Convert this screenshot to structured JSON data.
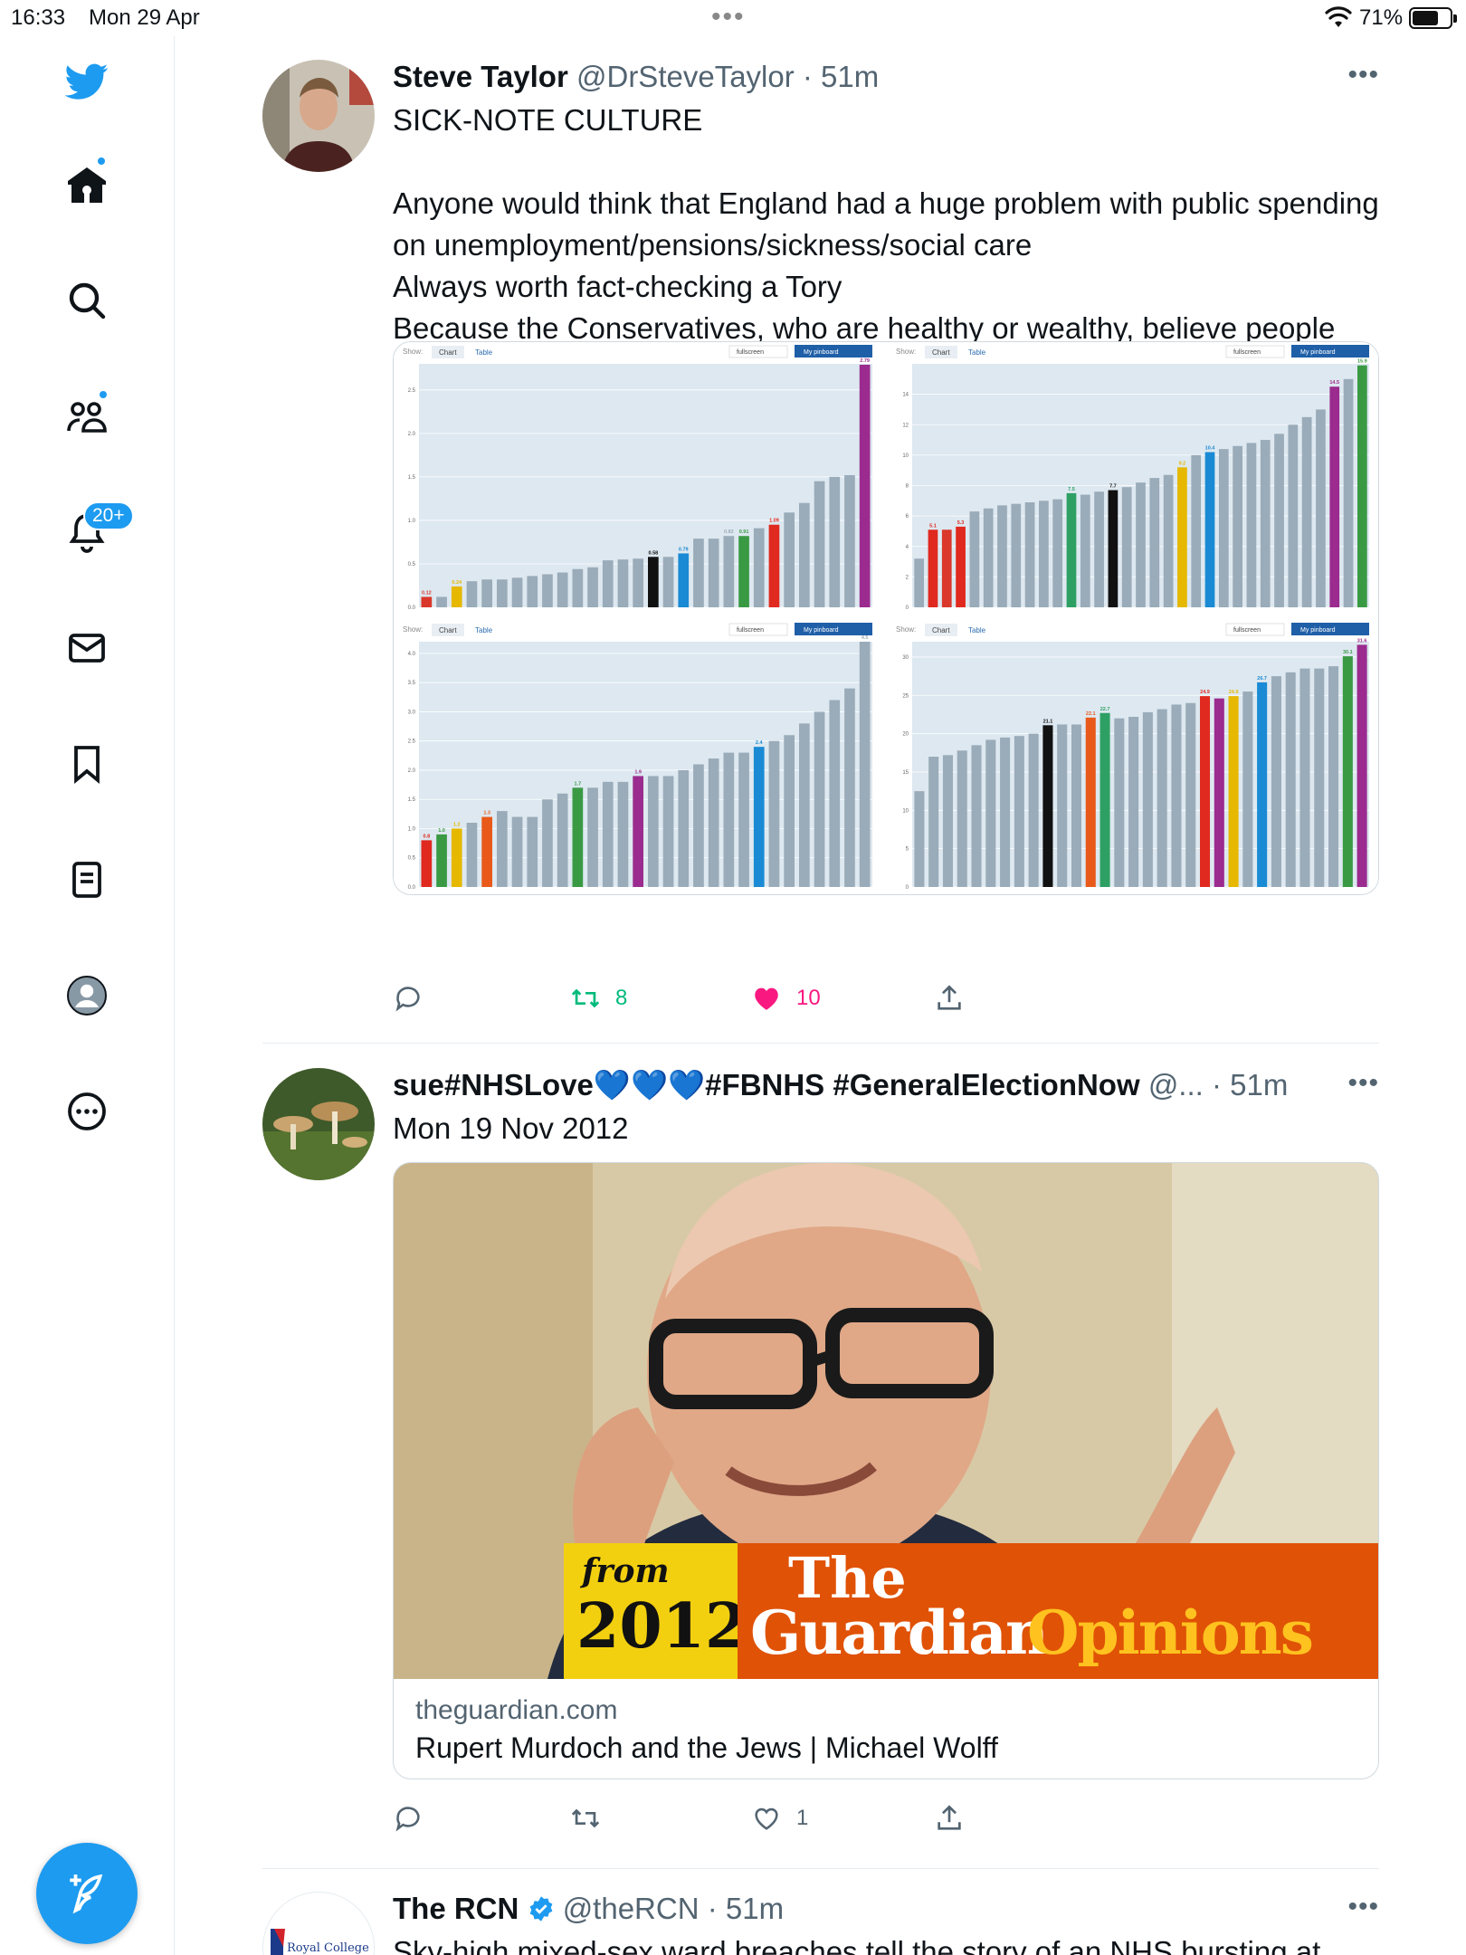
{
  "status_bar": {
    "time": "16:33",
    "date": "Mon 29 Apr",
    "battery": "71%",
    "battery_level": 0.71
  },
  "sidebar": {
    "notifications_badge": "20+"
  },
  "tweets": [
    {
      "name": "Steve Taylor",
      "handle": "@DrSteveTaylor",
      "time": "· 51m",
      "text": "SICK-NOTE CULTURE\n\nAnyone would think that England had a huge problem with public spending on unemployment/pensions/sickness/social care\nAlways worth fact-checking a Tory\nBecause the Conservatives, who are healthy or wealthy, believe people who have needs are unworthy of support",
      "retweets": "8",
      "likes": "10"
    },
    {
      "name": "sue#NHSLove💙💙💙#FBNHS #GeneralElectionNow",
      "handle": "@...",
      "time": "· 51m",
      "text": "Mon 19 Nov 2012",
      "card": {
        "banner_from": "from",
        "banner_year": "2012",
        "banner_the": "The",
        "banner_guardian": "Guardian",
        "banner_opinions": "Opinions",
        "domain": "theguardian.com",
        "title": "Rupert Murdoch and the Jews | Michael Wolff"
      },
      "retweets": "",
      "likes": "1"
    },
    {
      "name": "The RCN",
      "handle": "@theRCN",
      "time": "· 51m",
      "text": "Sky-high mixed-sex ward breaches tell the story of an NHS bursting at",
      "avatar_label": "Royal College"
    }
  ],
  "chart_ui": {
    "show": "Show:",
    "chart_tab": "Chart",
    "table_tab": "Table",
    "fullscreen": "fullscreen",
    "pinboard": "My pinboard"
  },
  "chart_data": [
    {
      "type": "bar",
      "ylim": [
        0,
        2.8
      ],
      "yticks": [
        "0.0",
        "0.5",
        "1.0",
        "1.5",
        "2.0",
        "2.5"
      ],
      "ytick_values": [
        0,
        0.5,
        1.0,
        1.5,
        2.0,
        2.5
      ],
      "values": [
        0.12,
        0.12,
        0.24,
        0.3,
        0.32,
        0.32,
        0.34,
        0.36,
        0.38,
        0.4,
        0.44,
        0.46,
        0.54,
        0.55,
        0.56,
        0.58,
        0.58,
        0.62,
        0.79,
        0.79,
        0.82,
        0.82,
        0.91,
        0.95,
        1.09,
        1.2,
        1.45,
        1.5,
        1.52,
        2.79
      ],
      "colors": [
        "#d9382b",
        "#9aabb9",
        "#e6b800",
        "#9aabb9",
        "#9aabb9",
        "#9aabb9",
        "#9aabb9",
        "#9aabb9",
        "#9aabb9",
        "#9aabb9",
        "#9aabb9",
        "#9aabb9",
        "#9aabb9",
        "#9aabb9",
        "#9aabb9",
        "#111111",
        "#9aabb9",
        "#1a8ad4",
        "#9aabb9",
        "#9aabb9",
        "#9aabb9",
        "#3a9a44",
        "#9aabb9",
        "#e0291f",
        "#9aabb9",
        "#9aabb9",
        "#9aabb9",
        "#9aabb9",
        "#9aabb9",
        "#9b2b8e"
      ],
      "labels": [
        "0.12",
        "",
        "0.24",
        "",
        "",
        "",
        "",
        "",
        "",
        "",
        "",
        "",
        "",
        "",
        "",
        "0.58",
        "",
        "0.79",
        "",
        "",
        "0.82",
        "0.91",
        "",
        "1.09",
        "",
        "",
        "",
        "",
        "",
        "2.79"
      ]
    },
    {
      "type": "bar",
      "ylim": [
        0,
        16
      ],
      "yticks": [
        "0",
        "2",
        "4",
        "6",
        "8",
        "10",
        "12",
        "14"
      ],
      "ytick_values": [
        0,
        2,
        4,
        6,
        8,
        10,
        12,
        14
      ],
      "values": [
        3.2,
        5.1,
        5.1,
        5.3,
        6.3,
        6.5,
        6.7,
        6.8,
        6.9,
        7.0,
        7.1,
        7.5,
        7.4,
        7.6,
        7.7,
        7.9,
        8.2,
        8.5,
        8.7,
        9.2,
        10.0,
        10.2,
        10.4,
        10.6,
        10.8,
        11.0,
        11.4,
        12.0,
        12.5,
        13.0,
        14.5,
        15.0,
        15.9
      ],
      "colors": [
        "#9aabb9",
        "#e0291f",
        "#d9382b",
        "#e0291f",
        "#9aabb9",
        "#9aabb9",
        "#9aabb9",
        "#9aabb9",
        "#9aabb9",
        "#9aabb9",
        "#9aabb9",
        "#2ea063",
        "#9aabb9",
        "#9aabb9",
        "#111111",
        "#9aabb9",
        "#9aabb9",
        "#9aabb9",
        "#9aabb9",
        "#e6b800",
        "#9aabb9",
        "#1a8ad4",
        "#9aabb9",
        "#9aabb9",
        "#9aabb9",
        "#9aabb9",
        "#9aabb9",
        "#9aabb9",
        "#9aabb9",
        "#9aabb9",
        "#9b2b8e",
        "#9aabb9",
        "#3a9a44"
      ],
      "labels": [
        "",
        "5.1",
        "",
        "5.3",
        "",
        "",
        "",
        "",
        "",
        "",
        "",
        "7.5",
        "",
        "",
        "7.7",
        "",
        "",
        "",
        "",
        "9.2",
        "",
        "10.4",
        "",
        "",
        "",
        "",
        "",
        "",
        "",
        "",
        "14.5",
        "",
        "15.9"
      ]
    },
    {
      "type": "bar",
      "ylim": [
        0,
        4.2
      ],
      "yticks": [
        "0.0",
        "0.5",
        "1.0",
        "1.5",
        "2.0",
        "2.5",
        "3.0",
        "3.5",
        "4.0"
      ],
      "ytick_values": [
        0,
        0.5,
        1.0,
        1.5,
        2.0,
        2.5,
        3.0,
        3.5,
        4.0
      ],
      "values": [
        0.8,
        0.9,
        1.0,
        1.1,
        1.2,
        1.3,
        1.2,
        1.2,
        1.5,
        1.6,
        1.7,
        1.7,
        1.8,
        1.8,
        1.9,
        1.9,
        1.9,
        2.0,
        2.1,
        2.2,
        2.3,
        2.3,
        2.4,
        2.5,
        2.6,
        2.8,
        3.0,
        3.2,
        3.4,
        4.5
      ],
      "colors": [
        "#e0291f",
        "#3a9a44",
        "#e6b800",
        "#9aabb9",
        "#e8591a",
        "#9aabb9",
        "#9aabb9",
        "#9aabb9",
        "#9aabb9",
        "#9aabb9",
        "#3a9a44",
        "#9aabb9",
        "#9aabb9",
        "#9aabb9",
        "#9b2b8e",
        "#9aabb9",
        "#9aabb9",
        "#9aabb9",
        "#9aabb9",
        "#9aabb9",
        "#9aabb9",
        "#9aabb9",
        "#1a8ad4",
        "#9aabb9",
        "#9aabb9",
        "#9aabb9",
        "#9aabb9",
        "#9aabb9",
        "#9aabb9",
        "#9aabb9"
      ],
      "labels": [
        "0.8",
        "1.0",
        "1.2",
        "",
        "1.3",
        "",
        "",
        "",
        "",
        "",
        "1.7",
        "",
        "",
        "",
        "1.9",
        "",
        "",
        "",
        "",
        "",
        "",
        "",
        "2.4",
        "",
        "",
        "",
        "",
        "",
        "",
        "4.5"
      ]
    },
    {
      "type": "bar",
      "ylim": [
        0,
        32
      ],
      "yticks": [
        "0",
        "5",
        "10",
        "15",
        "20",
        "25",
        "30"
      ],
      "ytick_values": [
        0,
        5,
        10,
        15,
        20,
        25,
        30
      ],
      "values": [
        12.5,
        17.0,
        17.2,
        17.8,
        18.5,
        19.2,
        19.5,
        19.7,
        20.0,
        21.1,
        21.2,
        21.2,
        22.1,
        22.7,
        22.0,
        22.2,
        22.8,
        23.2,
        23.8,
        24.0,
        24.9,
        24.6,
        24.9,
        25.5,
        26.7,
        27.5,
        28.0,
        28.5,
        28.5,
        28.8,
        30.1,
        31.6
      ],
      "colors": [
        "#9aabb9",
        "#9aabb9",
        "#9aabb9",
        "#9aabb9",
        "#9aabb9",
        "#9aabb9",
        "#9aabb9",
        "#9aabb9",
        "#9aabb9",
        "#111111",
        "#9aabb9",
        "#9aabb9",
        "#e8591a",
        "#2ea063",
        "#9aabb9",
        "#9aabb9",
        "#9aabb9",
        "#9aabb9",
        "#9aabb9",
        "#9aabb9",
        "#e0291f",
        "#9b2b8e",
        "#e6b800",
        "#9aabb9",
        "#1a8ad4",
        "#9aabb9",
        "#9aabb9",
        "#9aabb9",
        "#9aabb9",
        "#9aabb9",
        "#3a9a44",
        "#9b2b8e"
      ],
      "labels": [
        "",
        "",
        "",
        "",
        "",
        "",
        "",
        "",
        "",
        "21.1",
        "",
        "",
        "22.1",
        "22.7",
        "",
        "",
        "",
        "",
        "",
        "",
        "24.9",
        "",
        "24.9",
        "",
        "26.7",
        "",
        "",
        "",
        "",
        "",
        "30.1",
        "31.6"
      ]
    }
  ]
}
